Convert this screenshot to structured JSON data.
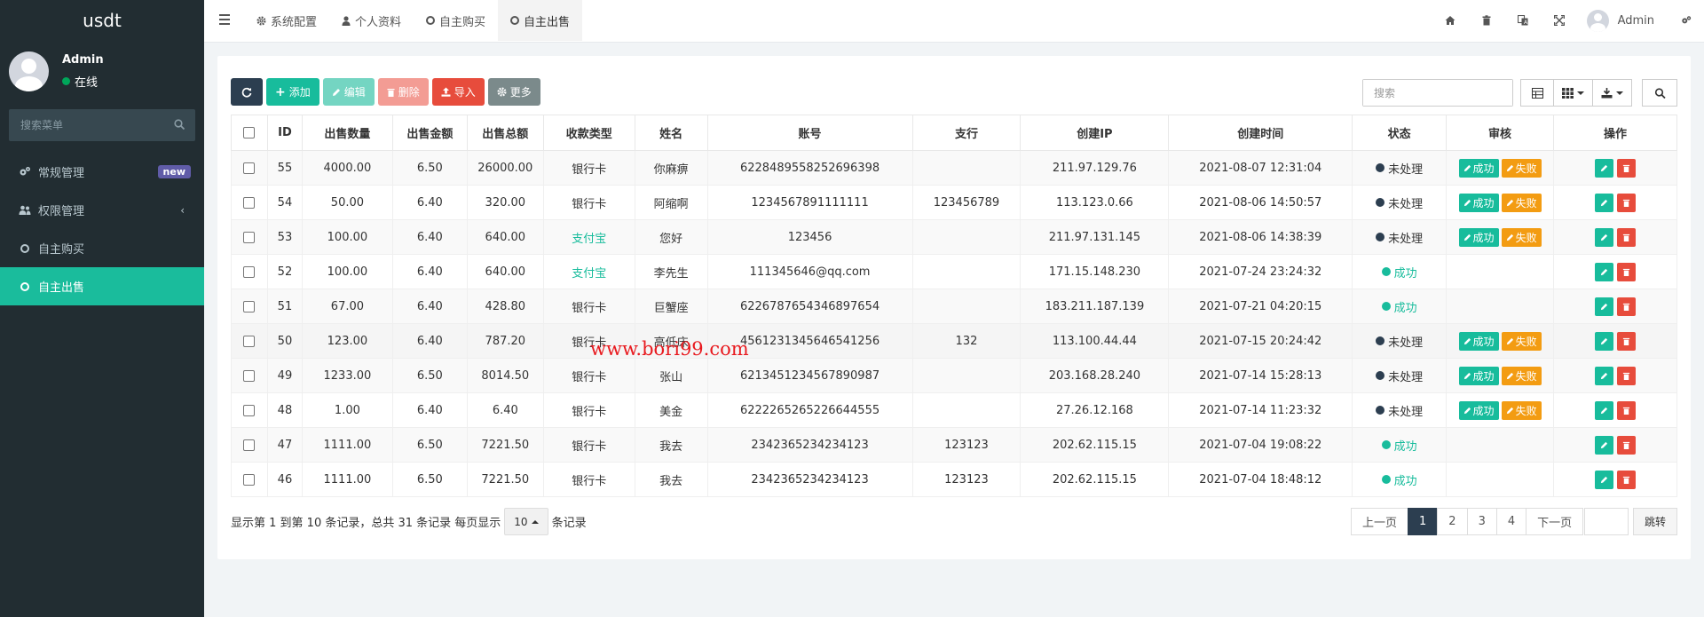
{
  "app": {
    "logo": "usdt"
  },
  "user": {
    "name": "Admin",
    "status": "在线"
  },
  "sidebar": {
    "search_placeholder": "搜索菜单",
    "items": [
      {
        "label": "常规管理",
        "badge": "new"
      },
      {
        "label": "权限管理",
        "chevron": "‹"
      },
      {
        "label": "自主购买"
      },
      {
        "label": "自主出售",
        "active": true
      }
    ]
  },
  "header": {
    "tabs": [
      "系统配置",
      "个人资料",
      "自主购买",
      "自主出售"
    ],
    "user": "Admin"
  },
  "toolbar": {
    "add": "添加",
    "edit": "编辑",
    "delete": "删除",
    "import": "导入",
    "more": "更多",
    "search_placeholder": "搜索"
  },
  "table": {
    "columns": [
      "ID",
      "出售数量",
      "出售金额",
      "出售总额",
      "收款类型",
      "姓名",
      "账号",
      "支行",
      "创建IP",
      "创建时间",
      "状态",
      "审核",
      "操作"
    ],
    "rows": [
      {
        "id": "55",
        "qty": "4000.00",
        "price": "6.50",
        "total": "26000.00",
        "type": "银行卡",
        "name": "你麻痹",
        "account": "6228489558252696398",
        "branch": "",
        "ip": "211.97.129.76",
        "time": "2021-08-07 12:31:04",
        "status": "未处理",
        "pending": true
      },
      {
        "id": "54",
        "qty": "50.00",
        "price": "6.40",
        "total": "320.00",
        "type": "银行卡",
        "name": "阿缩啊",
        "account": "1234567891111111",
        "branch": "123456789",
        "ip": "113.123.0.66",
        "time": "2021-08-06 14:50:57",
        "status": "未处理",
        "pending": true
      },
      {
        "id": "53",
        "qty": "100.00",
        "price": "6.40",
        "total": "640.00",
        "type": "支付宝",
        "name": "您好",
        "account": "123456",
        "branch": "",
        "ip": "211.97.131.145",
        "time": "2021-08-06 14:38:39",
        "status": "未处理",
        "pending": true
      },
      {
        "id": "52",
        "qty": "100.00",
        "price": "6.40",
        "total": "640.00",
        "type": "支付宝",
        "name": "李先生",
        "account": "111345646@qq.com",
        "branch": "",
        "ip": "171.15.148.230",
        "time": "2021-07-24 23:24:32",
        "status": "成功",
        "pending": false
      },
      {
        "id": "51",
        "qty": "67.00",
        "price": "6.40",
        "total": "428.80",
        "type": "银行卡",
        "name": "巨蟹座",
        "account": "6226787654346897654",
        "branch": "",
        "ip": "183.211.187.139",
        "time": "2021-07-21 04:20:15",
        "status": "成功",
        "pending": false
      },
      {
        "id": "50",
        "qty": "123.00",
        "price": "6.40",
        "total": "787.20",
        "type": "银行卡",
        "name": "高低床",
        "account": "4561231345646541256",
        "branch": "132",
        "ip": "113.100.44.44",
        "time": "2021-07-15 20:24:42",
        "status": "未处理",
        "pending": true
      },
      {
        "id": "49",
        "qty": "1233.00",
        "price": "6.50",
        "total": "8014.50",
        "type": "银行卡",
        "name": "张山",
        "account": "6213451234567890987",
        "branch": "",
        "ip": "203.168.28.240",
        "time": "2021-07-14 15:28:13",
        "status": "未处理",
        "pending": true
      },
      {
        "id": "48",
        "qty": "1.00",
        "price": "6.40",
        "total": "6.40",
        "type": "银行卡",
        "name": "美金",
        "account": "6222265265226644555",
        "branch": "",
        "ip": "27.26.12.168",
        "time": "2021-07-14 11:23:32",
        "status": "未处理",
        "pending": true
      },
      {
        "id": "47",
        "qty": "1111.00",
        "price": "6.50",
        "total": "7221.50",
        "type": "银行卡",
        "name": "我去",
        "account": "2342365234234123",
        "branch": "123123",
        "ip": "202.62.115.15",
        "time": "2021-07-04 19:08:22",
        "status": "成功",
        "pending": false
      },
      {
        "id": "46",
        "qty": "1111.00",
        "price": "6.50",
        "total": "7221.50",
        "type": "银行卡",
        "name": "我去",
        "account": "2342365234234123",
        "branch": "123123",
        "ip": "202.62.115.15",
        "time": "2021-07-04 18:48:12",
        "status": "成功",
        "pending": false
      }
    ],
    "approve_label": "成功",
    "reject_label": "失败"
  },
  "pagination": {
    "info_prefix": "显示第 1 到第 10 条记录，总共 31 条记录 每页显示",
    "page_size": "10",
    "info_suffix": "条记录",
    "prev": "上一页",
    "pages": [
      "1",
      "2",
      "3",
      "4"
    ],
    "next": "下一页",
    "jump": "跳转"
  },
  "watermark": "www.bori99.com",
  "colors": {
    "sidebar": "#222d32",
    "accent": "#18bc9c",
    "danger": "#e74c3c",
    "warning": "#f39c12",
    "dark": "#2c3e50"
  }
}
